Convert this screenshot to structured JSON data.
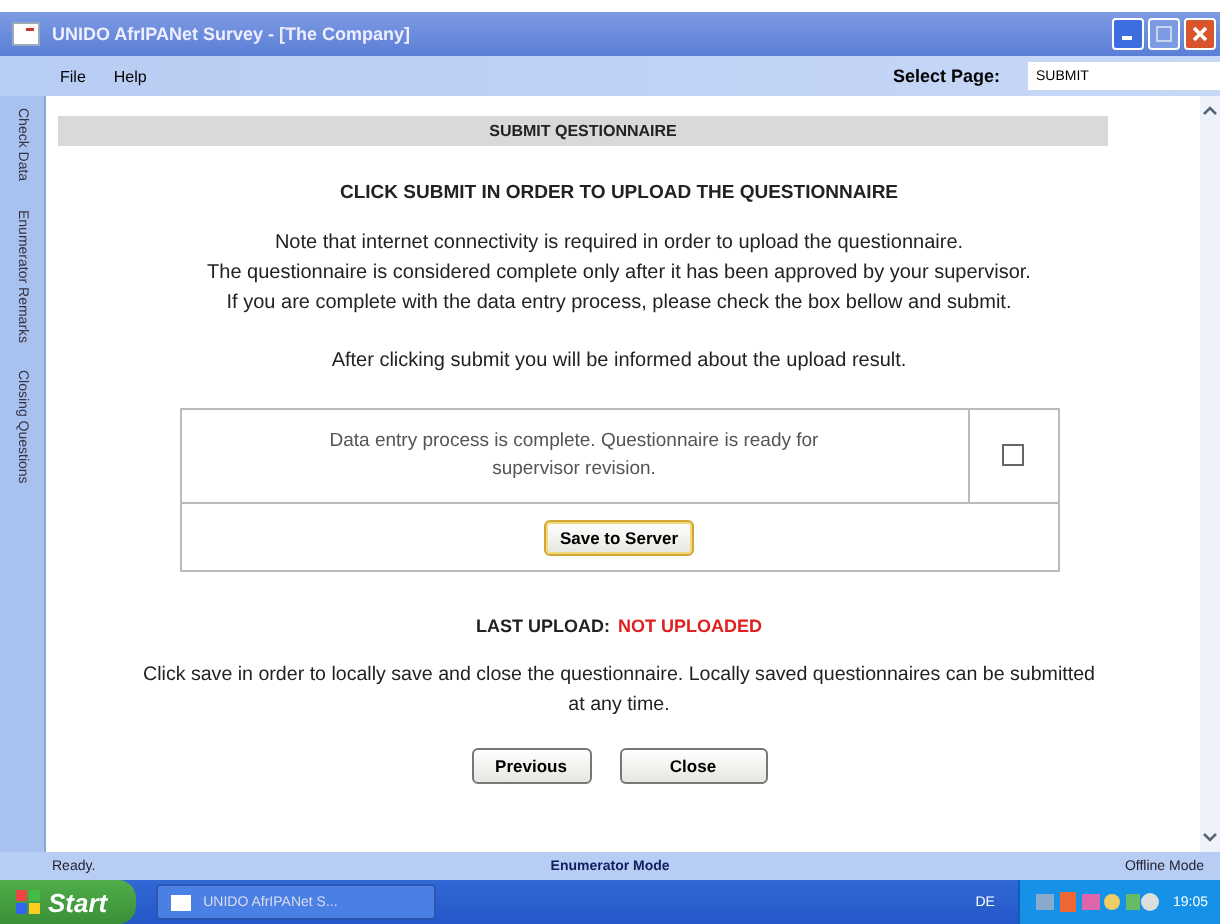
{
  "window": {
    "title": "UNIDO AfrIPANet Survey - [The Company]"
  },
  "menu": [
    "File",
    "Help"
  ],
  "select_page": {
    "label": "Select Page:",
    "value": "SUBMIT"
  },
  "side_tabs": [
    "Check Data",
    "Enumerator Remarks",
    "Closing Questions"
  ],
  "content": {
    "section_title": "SUBMIT QESTIONNAIRE",
    "heading": "CLICK SUBMIT IN ORDER TO UPLOAD THE QUESTIONNAIRE",
    "paragraphs": [
      "Note that internet connectivity is required in order to upload the questionnaire.",
      "The questionnaire is considered complete only after it has been approved by your supervisor.",
      "If you are complete with the data entry process, please check the box bellow and submit."
    ],
    "note": "After clicking submit you will be informed about the upload result.",
    "confirmation": {
      "text": "Data entry process is complete. Questionnaire is ready for supervisor revision.",
      "checked": false
    },
    "save_button": "Save to Server",
    "last_upload": {
      "label": "LAST UPLOAD:",
      "value": "NOT UPLOADED"
    },
    "footer_text": "Click save in order to locally save and close the questionnaire. Locally saved questionnaires can be submitted at any time.",
    "buttons": [
      "Previous",
      "Close"
    ]
  },
  "status_bar": {
    "left": "Ready.",
    "center": "Enumerator Mode",
    "right": "Offline Mode"
  },
  "taskbar": {
    "start": "Start",
    "task": "UNIDO AfrIPANet S...",
    "language": "DE",
    "clock": "19:05"
  }
}
